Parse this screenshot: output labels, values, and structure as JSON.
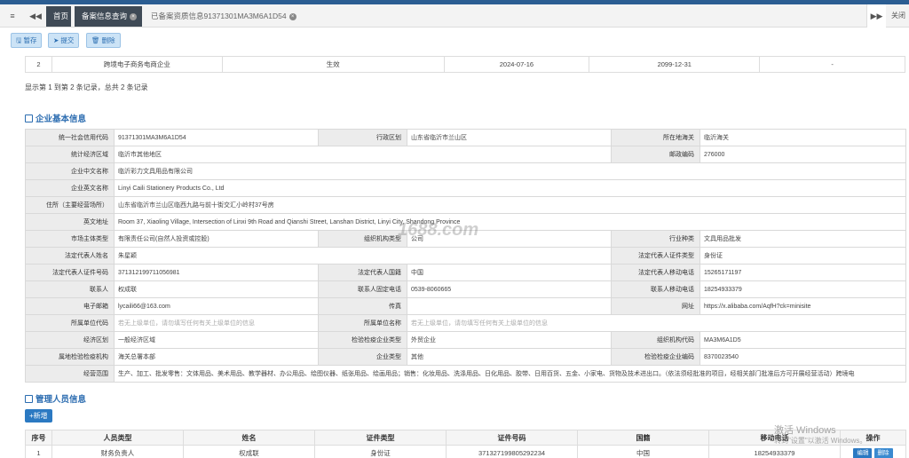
{
  "tabs": {
    "home": "首页",
    "query": "备案信息查询",
    "current": "已备案资质信息91371301MA3M6A1D54",
    "close_right": "关闭"
  },
  "toolbar": {
    "save": "暂存",
    "submit": "提交",
    "delete": "删除"
  },
  "top_table_row": [
    "2",
    "跨境电子商务电商企业",
    "生效",
    "2024-07-16",
    "2099-12-31",
    "-"
  ],
  "page_info": "显示第 1 到第 2 条记录，总共 2 条记录",
  "basic_info": {
    "title": "企业基本信息",
    "rows": [
      [
        "统一社会信用代码",
        "91371301MA3M6A1D54",
        "行政区划",
        "山东省临沂市兰山区",
        "所在地海关",
        "临沂海关"
      ],
      [
        "统计经济区域",
        "临沂市其他地区",
        "",
        "",
        "邮政编码",
        "276000"
      ],
      [
        "企业中文名称",
        "临沂彩力文具用品有限公司"
      ],
      [
        "企业英文名称",
        "Linyi Caili Stationery Products Co., Ltd"
      ],
      [
        "住所（主要经营场所）",
        "山东省临沂市兰山区临西九路与前十街交汇小岭村37号房"
      ],
      [
        "英文地址",
        "Room 37, Xiaoling Village, Intersection of Linxi 9th Road and Qianshi Street, Lanshan District, Linyi City, Shandong Province"
      ],
      [
        "市场主体类型",
        "有限责任公司(自然人投资或控股)",
        "组织机构类型",
        "公司",
        "行业种类",
        "文具用品批发"
      ],
      [
        "法定代表人姓名",
        "朱星颖",
        "",
        "",
        "法定代表人证件类型",
        "身份证"
      ],
      [
        "法定代表人证件号码",
        "371312199711056981",
        "法定代表人国籍",
        "中国",
        "法定代表人移动电话",
        "15265171197"
      ],
      [
        "联系人",
        "权成联",
        "联系人固定电话",
        "0539-8060665",
        "联系人移动电话",
        "18254933379"
      ],
      [
        "电子邮箱",
        "lycaili66@163.com",
        "传真",
        "",
        "网址",
        "https://x.alibaba.com/AqfH?ck=minisite"
      ],
      [
        "所属单位代码",
        "若无上级单位，请勿填写任何有关上级单位的信息",
        "所属单位名称",
        "若无上级单位，请勿填写任何有关上级单位的信息"
      ],
      [
        "经济区划",
        "一般经济区域",
        "检验检疫企业类型",
        "外贸企业",
        "组织机构代码",
        "MA3M6A1D5"
      ],
      [
        "属地检验检疫机构",
        "海关总署本部",
        "企业类型",
        "其他",
        "检验检疫企业编码",
        "8370023540"
      ],
      [
        "经营范围",
        "生产、加工、批发零售：文体用品、美术用品、教学器材、办公用品、绘图仪器、纸张用品、绘画用品；销售：化妆用品、洗涤用品、日化用品、胶带、日用百货、五金、小家电、货物及技术进出口。（依法须经批准的项目，经相关部门批准后方可开展经营活动）跨境电"
      ]
    ]
  },
  "managers": {
    "title": "管理人员信息",
    "add_label": "新增",
    "columns": [
      "序号",
      "人员类型",
      "姓名",
      "证件类型",
      "证件号码",
      "国籍",
      "移动电话",
      "操作"
    ],
    "rows": [
      [
        "1",
        "财务负责人",
        "权成联",
        "身份证",
        "371327199805292234",
        "中国",
        "18254933379"
      ]
    ],
    "edit_label": "编辑",
    "delete_label": "删除"
  },
  "overlays": {
    "watermark": "1688.com",
    "activate_title": "激活 Windows",
    "activate_sub": "转到\"设置\"以激活 Windows。"
  },
  "colors": {
    "accent": "#2b6cb0",
    "header_dark": "#3f4a56",
    "button": "#2b79c2"
  }
}
